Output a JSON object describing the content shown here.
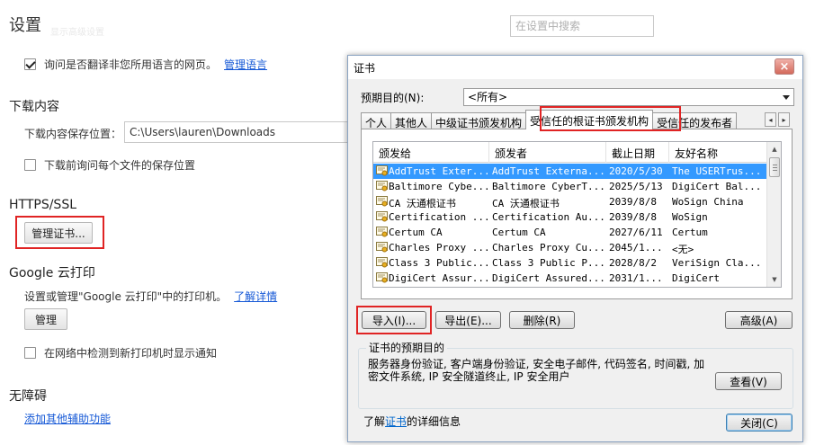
{
  "settings": {
    "title": "设置",
    "ghost_text": "显示高级设置",
    "search_placeholder": "在设置中搜索",
    "translate_checkbox": {
      "label": "询问是否翻译非您所用语言的网页。",
      "checked": true
    },
    "manage_languages_link": "管理语言",
    "downloads": {
      "heading": "下载内容",
      "location_label": "下载内容保存位置：",
      "location_value": "C:\\Users\\lauren\\Downloads",
      "ask_each_file_label": "下载前询问每个文件的保存位置",
      "ask_each_file_checked": false
    },
    "https": {
      "heading": "HTTPS/SSL",
      "manage_certs_button": "管理证书..."
    },
    "cloud_print": {
      "heading": "Google 云打印",
      "description": "设置或管理\"Google 云打印\"中的打印机。",
      "learn_more_link": "了解详情",
      "manage_button": "管理",
      "notify_label": "在网络中检测到新打印机时显示通知",
      "notify_checked": false
    },
    "accessibility": {
      "heading": "无障碍",
      "add_features_link": "添加其他辅助功能"
    }
  },
  "dialog": {
    "title": "证书",
    "close_symbol": "×",
    "purpose_label": "预期目的(N):",
    "purpose_value": "<所有>",
    "tabs": [
      {
        "label": "个人"
      },
      {
        "label": "其他人"
      },
      {
        "label": "中级证书颁发机构"
      },
      {
        "label": "受信任的根证书颁发机构",
        "active": true
      },
      {
        "label": "受信任的发布者"
      }
    ],
    "tab_scroll_left": "◂",
    "tab_scroll_right": "▸",
    "columns": [
      "颁发给",
      "颁发者",
      "截止日期",
      "友好名称"
    ],
    "rows": [
      {
        "issued_to": "AddTrust Exter...",
        "issued_by": "AddTrust Externa...",
        "expires": "2020/5/30",
        "friendly": "The USERTrus...",
        "selected": true
      },
      {
        "issued_to": "Baltimore Cybe...",
        "issued_by": "Baltimore CyberT...",
        "expires": "2025/5/13",
        "friendly": "DigiCert Bal..."
      },
      {
        "issued_to": "CA 沃通根证书",
        "issued_by": "CA 沃通根证书",
        "expires": "2039/8/8",
        "friendly": "WoSign China"
      },
      {
        "issued_to": "Certification ...",
        "issued_by": "Certification Au...",
        "expires": "2039/8/8",
        "friendly": "WoSign"
      },
      {
        "issued_to": "Certum CA",
        "issued_by": "Certum CA",
        "expires": "2027/6/11",
        "friendly": "Certum"
      },
      {
        "issued_to": "Charles Proxy ...",
        "issued_by": "Charles Proxy Cu...",
        "expires": "2045/1...",
        "friendly": "<无>"
      },
      {
        "issued_to": "Class 3 Public...",
        "issued_by": "Class 3 Public P...",
        "expires": "2028/8/2",
        "friendly": "VeriSign Cla..."
      },
      {
        "issued_to": "DigiCert Assur...",
        "issued_by": "DigiCert Assured...",
        "expires": "2031/1...",
        "friendly": "DigiCert"
      }
    ],
    "buttons": {
      "import": "导入(I)...",
      "export": "导出(E)...",
      "remove": "删除(R)",
      "advanced": "高级(A)",
      "view": "查看(V)",
      "close": "关闭(C)"
    },
    "purposes_group_title": "证书的预期目的",
    "purposes_text": "服务器身份验证, 客户端身份验证, 安全电子邮件, 代码签名, 时间戳, 加密文件系统, IP 安全隧道终止, IP 安全用户",
    "footer_prefix": "了解",
    "footer_link": "证书",
    "footer_suffix": "的详细信息"
  }
}
